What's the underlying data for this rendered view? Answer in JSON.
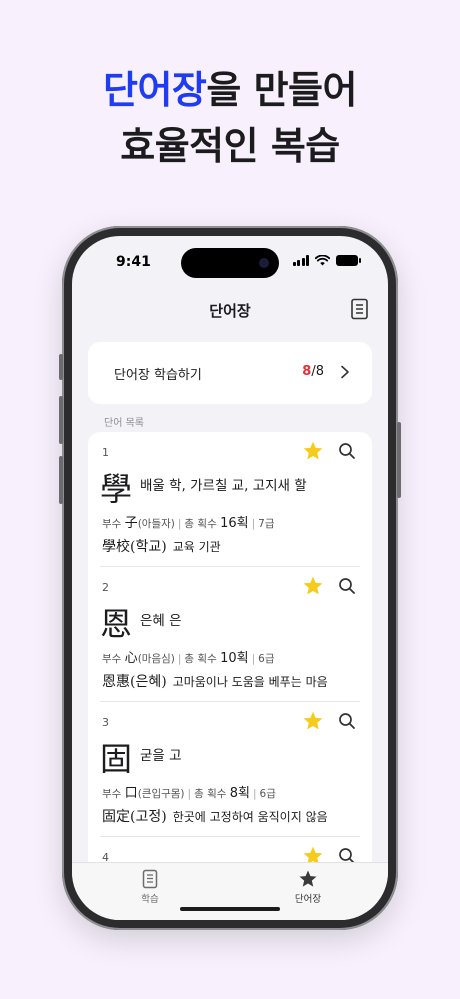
{
  "headline": {
    "accent": "단어장",
    "line1_rest": "을 만들어",
    "line2": "효율적인 복습"
  },
  "status": {
    "time": "9:41"
  },
  "nav": {
    "title": "단어장"
  },
  "study": {
    "label": "단어장 학습하기",
    "done": "8",
    "total": "/8"
  },
  "section_label": "단어 목록",
  "entries": [
    {
      "num": "1",
      "hanja": "學",
      "meaning": "배울 학, 가르칠 교, 고지새 할",
      "radical_prefix": "부수",
      "radical": "子",
      "radical_name": "(아들자)",
      "strokes_label": "총 획수",
      "strokes": "16획",
      "grade": "7급",
      "example_word": "學校(학교)",
      "example_meaning": "교육 기관"
    },
    {
      "num": "2",
      "hanja": "恩",
      "meaning": "은혜 은",
      "radical_prefix": "부수",
      "radical": "心",
      "radical_name": "(마음심)",
      "strokes_label": "총 획수",
      "strokes": "10획",
      "grade": "6급",
      "example_word": "恩惠(은혜)",
      "example_meaning": "고마움이나 도움을 베푸는 마음"
    },
    {
      "num": "3",
      "hanja": "固",
      "meaning": "굳을 고",
      "radical_prefix": "부수",
      "radical": "口",
      "radical_name": "(큰입구몸)",
      "strokes_label": "총 획수",
      "strokes": "8획",
      "grade": "6급",
      "example_word": "固定(고정)",
      "example_meaning": "한곳에 고정하여 움직이지 않음"
    },
    {
      "num": "4"
    }
  ],
  "tabs": [
    {
      "label": "학습",
      "icon": "book-icon"
    },
    {
      "label": "단어장",
      "icon": "star-icon"
    }
  ],
  "colors": {
    "accent": "#1f3cf0",
    "star": "#f5cc1b",
    "highlight": "#e0323c",
    "background": "#f8f1fd"
  }
}
